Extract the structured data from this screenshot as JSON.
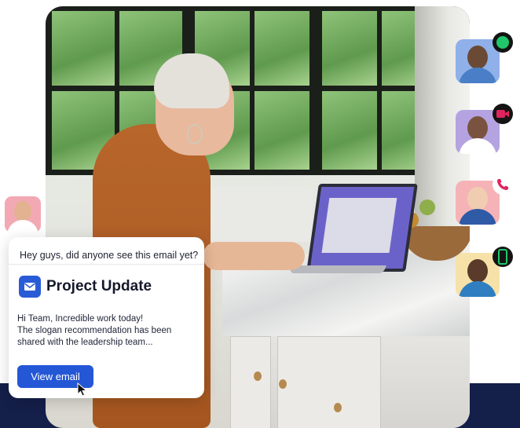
{
  "chat": {
    "message": "Hey guys, did anyone see this email yet?",
    "email": {
      "title": "Project Update",
      "body_lines": [
        "Hi Team, Incredible work today!",
        "The slogan recommendation has been",
        "shared with the leadership team..."
      ],
      "button_label": "View email"
    }
  },
  "participants": [
    {
      "status": "online",
      "icon": "online-status-dot",
      "color": "#1fc76a"
    },
    {
      "status": "video",
      "icon": "video-camera-icon",
      "color": "#e0245e"
    },
    {
      "status": "phone",
      "icon": "phone-icon",
      "color": "#e0245e"
    },
    {
      "status": "mobile",
      "icon": "mobile-phone-icon",
      "color": "#1fc76a"
    }
  ],
  "colors": {
    "brand_blue": "#2457d6",
    "navy": "#141f4a"
  }
}
